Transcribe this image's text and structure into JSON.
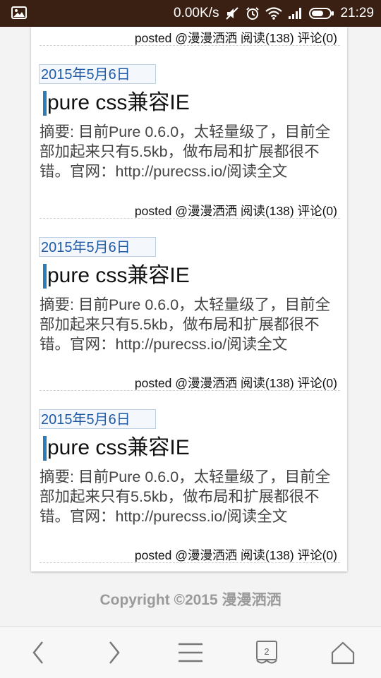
{
  "status_bar": {
    "net_speed": "0.00K/s",
    "time": "21:29"
  },
  "posts": [
    {
      "date": "",
      "title": "",
      "summary": "",
      "footer": "posted @漫漫洒洒 阅读(138) 评论(0)"
    },
    {
      "date": "2015年5月6日",
      "title": "pure css兼容IE",
      "summary": "摘要: 目前Pure 0.6.0，太轻量级了，目前全部加起来只有5.5kb，做布局和扩展都很不错。官网：http://purecss.io/阅读全文",
      "footer": "posted @漫漫洒洒 阅读(138) 评论(0)"
    },
    {
      "date": "2015年5月6日",
      "title": "pure css兼容IE",
      "summary": "摘要: 目前Pure 0.6.0，太轻量级了，目前全部加起来只有5.5kb，做布局和扩展都很不错。官网：http://purecss.io/阅读全文",
      "footer": "posted @漫漫洒洒 阅读(138) 评论(0)"
    },
    {
      "date": "2015年5月6日",
      "title": "pure css兼容IE",
      "summary": "摘要: 目前Pure 0.6.0，太轻量级了，目前全部加起来只有5.5kb，做布局和扩展都很不错。官网：http://purecss.io/阅读全文",
      "footer": "posted @漫漫洒洒 阅读(138) 评论(0)"
    }
  ],
  "copyright": "Copyright ©2015 漫漫洒洒",
  "toolbar": {
    "tab_count": "2",
    "icons": [
      "back-arrow-icon",
      "forward-arrow-icon",
      "menu-icon",
      "tabs-icon",
      "home-icon"
    ]
  },
  "colors": {
    "status_bar_bg": "#3a2012",
    "date_text": "#1f5aa8",
    "title_accent": "#2e7cb7",
    "summary_text": "#444444",
    "copyright_text": "#9a9a9a"
  }
}
